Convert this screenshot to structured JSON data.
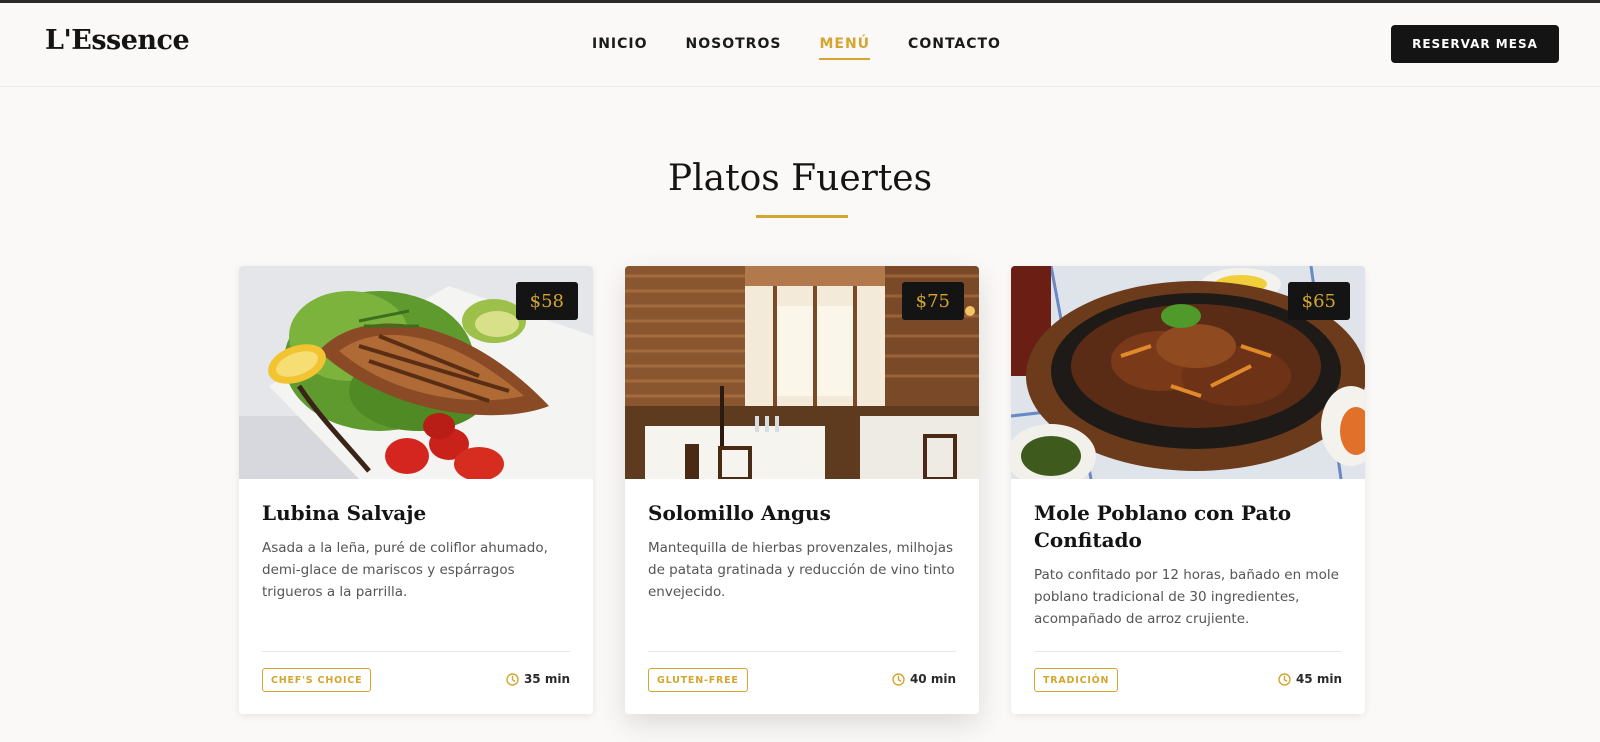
{
  "brand": {
    "logo": "L'Essence"
  },
  "nav": {
    "items": [
      {
        "label": "INICIO",
        "active": false
      },
      {
        "label": "NOSOTROS",
        "active": false
      },
      {
        "label": "MENÚ",
        "active": true
      },
      {
        "label": "CONTACTO",
        "active": false
      }
    ],
    "cta_label": "RESERVAR MESA"
  },
  "section": {
    "title": "Platos Fuertes"
  },
  "dishes": [
    {
      "name": "Lubina Salvaje",
      "description": "Asada a la leña, puré de coliflor ahumado, demi-glace de mariscos y espárragos trigueros a la parrilla.",
      "price": "$58",
      "tag": "CHEF'S CHOICE",
      "time": "35 min",
      "image": "grilled-salmon-plate-photo"
    },
    {
      "name": "Solomillo Angus",
      "description": "Mantequilla de hierbas provenzales, milhojas de patata gratinada y reducción de vino tinto envejecido.",
      "price": "$75",
      "tag": "GLUTEN-FREE",
      "time": "40 min",
      "image": "restaurant-dining-room-photo"
    },
    {
      "name": "Mole Poblano con Pato Confitado",
      "description": "Pato confitado por 12 horas, bañado en mole poblano tradicional de 30 ingredientes, acompañado de arroz crujiente.",
      "price": "$65",
      "tag": "TRADICIÓN",
      "time": "45 min",
      "image": "sizzling-beef-skillet-photo"
    }
  ],
  "colors": {
    "accent": "#d4a52f",
    "dark": "#141414",
    "background": "#faf9f7"
  },
  "icons": {
    "time": "clock-icon"
  }
}
